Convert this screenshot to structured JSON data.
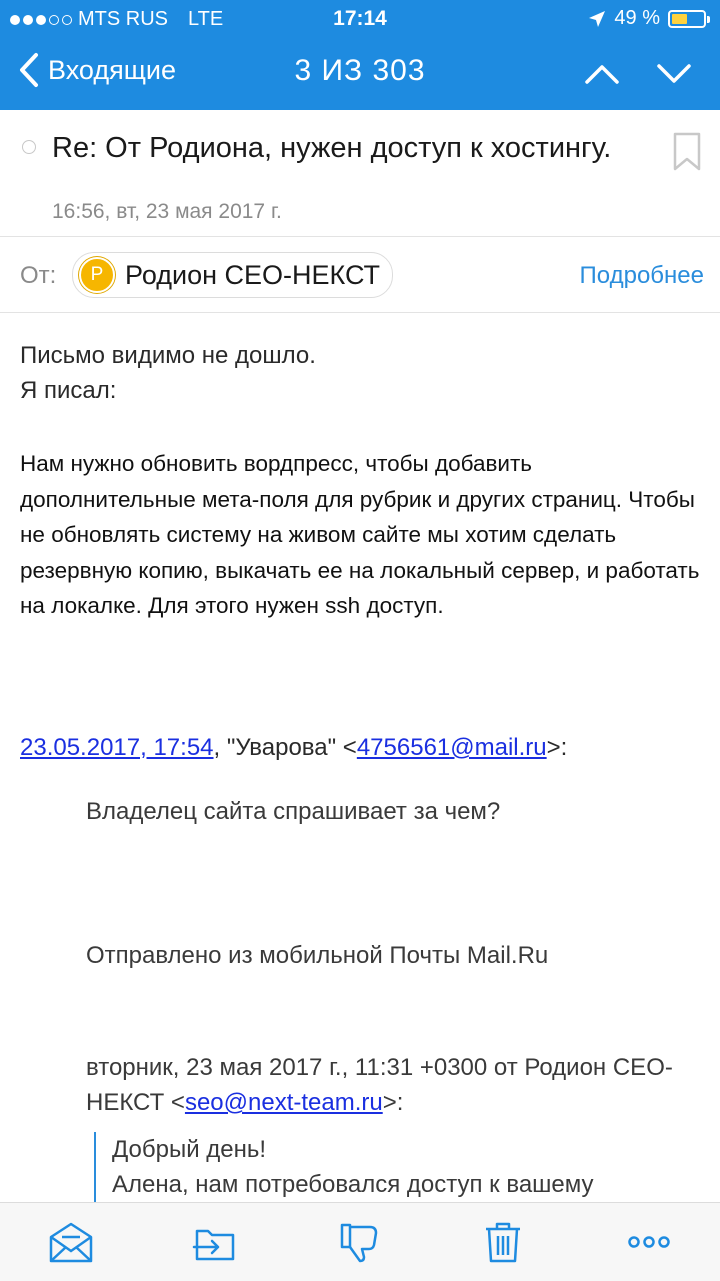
{
  "status_bar": {
    "carrier": "MTS RUS",
    "network": "LTE",
    "time": "17:14",
    "battery": "49 %",
    "battery_level": 0.49
  },
  "nav": {
    "back_label": "Входящие",
    "counter": "3 ИЗ 303"
  },
  "message": {
    "subject": "Re: От Родиона, нужен доступ к хостингу.",
    "date": "16:56, вт, 23 мая 2017 г.",
    "from_label": "От:",
    "sender_initial": "Р",
    "sender_name": "Родион СЕО-НЕКСТ",
    "details_link": "Подробнее"
  },
  "body": {
    "line1": "Письмо видимо не дошло.",
    "line2": "Я писал:",
    "paragraph": "Нам нужно обновить вордпресс, чтобы добавить дополнительные мета-поля для рубрик и других страниц. Чтобы не обновлять систему на живом сайте мы хотим сделать резервную копию, выкачать ее на локальный сервер, и работать на локалке. Для этого нужен ssh доступ.",
    "quote_date": "23.05.2017, 17:54",
    "quote_author": ", \"Уварова\" <",
    "quote_email": "4756561@mail.ru",
    "quote_suffix": ">:",
    "quote_line": "Владелец сайта спрашивает за чем?",
    "signature": "Отправлено из мобильной Почты Mail.Ru",
    "nested_header": "вторник, 23 мая 2017 г., 11:31 +0300 от Родион СЕО-НЕКСТ <",
    "nested_email": "seo@next-team.ru",
    "nested_suffix": ">:",
    "nested_line1": "Добрый день!",
    "nested_line2": "Алена, нам потребовался доступ к вашему"
  },
  "colors": {
    "accent": "#1E8BE0",
    "link": "#1A2FE0",
    "avatar": "#F6B600"
  },
  "toolbar": {
    "icons": [
      "mark-unread-icon",
      "move-to-folder-icon",
      "spam-icon",
      "trash-icon",
      "more-icon"
    ]
  }
}
